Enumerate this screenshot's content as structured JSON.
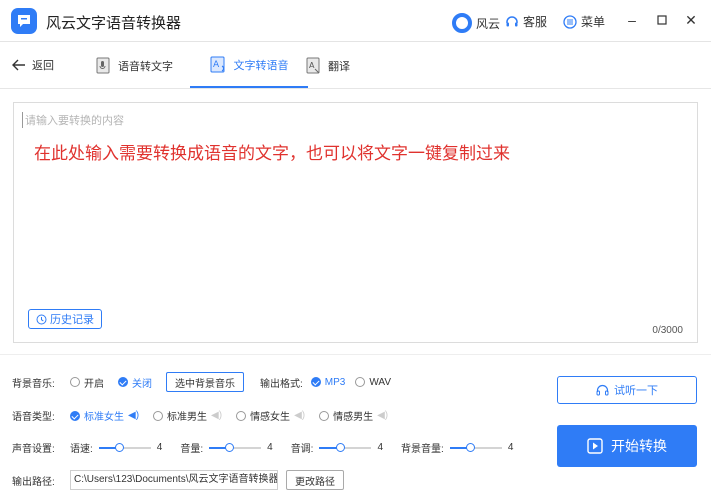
{
  "app": {
    "title": "风云文字语音转换器"
  },
  "titlebar": {
    "brand_label": "风云",
    "service_label": "客服",
    "menu_label": "菜单"
  },
  "nav": {
    "back_label": "返回",
    "tabs": [
      {
        "label": "语音转文字"
      },
      {
        "label": "文字转语音"
      },
      {
        "label": "翻译"
      }
    ]
  },
  "editor": {
    "placeholder": "请输入要转换的内容",
    "hint": "在此处输入需要转换成语音的文字，也可以将文字一键复制过来",
    "history_label": "历史记录",
    "char_count": "0/3000"
  },
  "settings": {
    "bg_music": {
      "label": "背景音乐:",
      "on_label": "开启",
      "off_label": "关闭",
      "selected": "关闭",
      "choose_label": "选中背景音乐"
    },
    "format": {
      "label": "输出格式:",
      "options": [
        "MP3",
        "WAV"
      ],
      "selected": "MP3"
    },
    "voice": {
      "label": "语音类型:",
      "options": [
        "标准女生",
        "标准男生",
        "情感女生",
        "情感男生"
      ],
      "selected": "标准女生"
    },
    "sound": {
      "label": "声音设置:",
      "sliders": [
        {
          "label": "语速:",
          "value": "4",
          "fraction": 0.4
        },
        {
          "label": "音量:",
          "value": "4",
          "fraction": 0.4
        },
        {
          "label": "音调:",
          "value": "4",
          "fraction": 0.4
        },
        {
          "label": "背景音量:",
          "value": "4",
          "fraction": 0.4
        }
      ]
    },
    "output": {
      "label": "输出路径:",
      "path": "C:\\Users\\123\\Documents\\风云文字语音转换器",
      "change_label": "更改路径"
    }
  },
  "actions": {
    "try_label": "试听一下",
    "start_label": "开始转换"
  },
  "colors": {
    "accent": "#2f7cf6",
    "hint": "#e0322e"
  }
}
